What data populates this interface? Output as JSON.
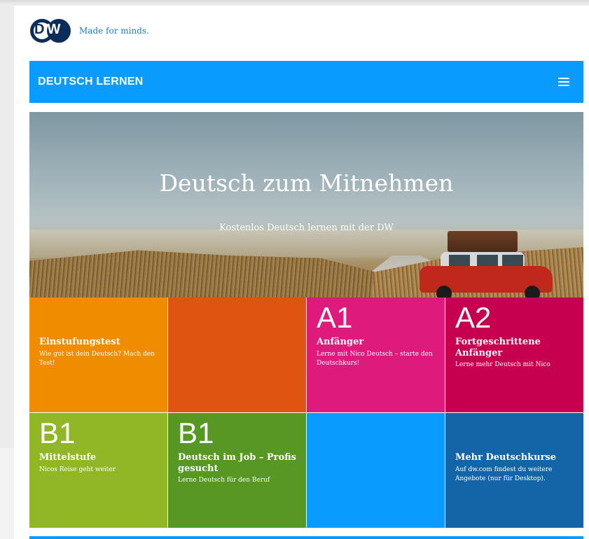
{
  "brand": {
    "logo_text_d": "D",
    "logo_text_w": "W",
    "tagline": "Made for minds.",
    "navy": "#0c2d5a",
    "tagline_color": "#1b7cc4"
  },
  "header": {
    "title": "DEUTSCH LERNEN",
    "menu_icon": "hamburger-menu-icon",
    "background": "#0a9bff"
  },
  "hero": {
    "title": "Deutsch zum Mitnehmen",
    "subtitle": "Kostenlos Deutsch lernen mit der DW"
  },
  "tiles": [
    {
      "level": "",
      "title": "Einstufungstest",
      "description": "Wie gut ist dein Deutsch? Mach den Test!",
      "color": "#f08c00"
    },
    {
      "level": "",
      "title": "",
      "description": "",
      "color": "#e05412"
    },
    {
      "level": "A1",
      "title": "Anfänger",
      "description": "Lerne mit Nico Deutsch – starte den Deutschkurs!",
      "color": "#de1a7d"
    },
    {
      "level": "A2",
      "title": "Fortgeschrittene Anfänger",
      "description": "Lerne mehr Deutsch mit Nico",
      "color": "#c6004e"
    },
    {
      "level": "B1",
      "title": "Mittelstufe",
      "description": "Nicos Reise geht weiter",
      "color": "#91b726"
    },
    {
      "level": "B1",
      "title": "Deutsch im Job – Profis gesucht",
      "description": "Lerne Deutsch für den Beruf",
      "color": "#579723"
    },
    {
      "level": "",
      "title": "",
      "description": "",
      "color": "#0a9bff"
    },
    {
      "level": "",
      "title": "Mehr Deutschkurse",
      "description": "Auf dw.com findest du weitere Angebote (nur für Desktop).",
      "color": "#1465a8"
    }
  ]
}
